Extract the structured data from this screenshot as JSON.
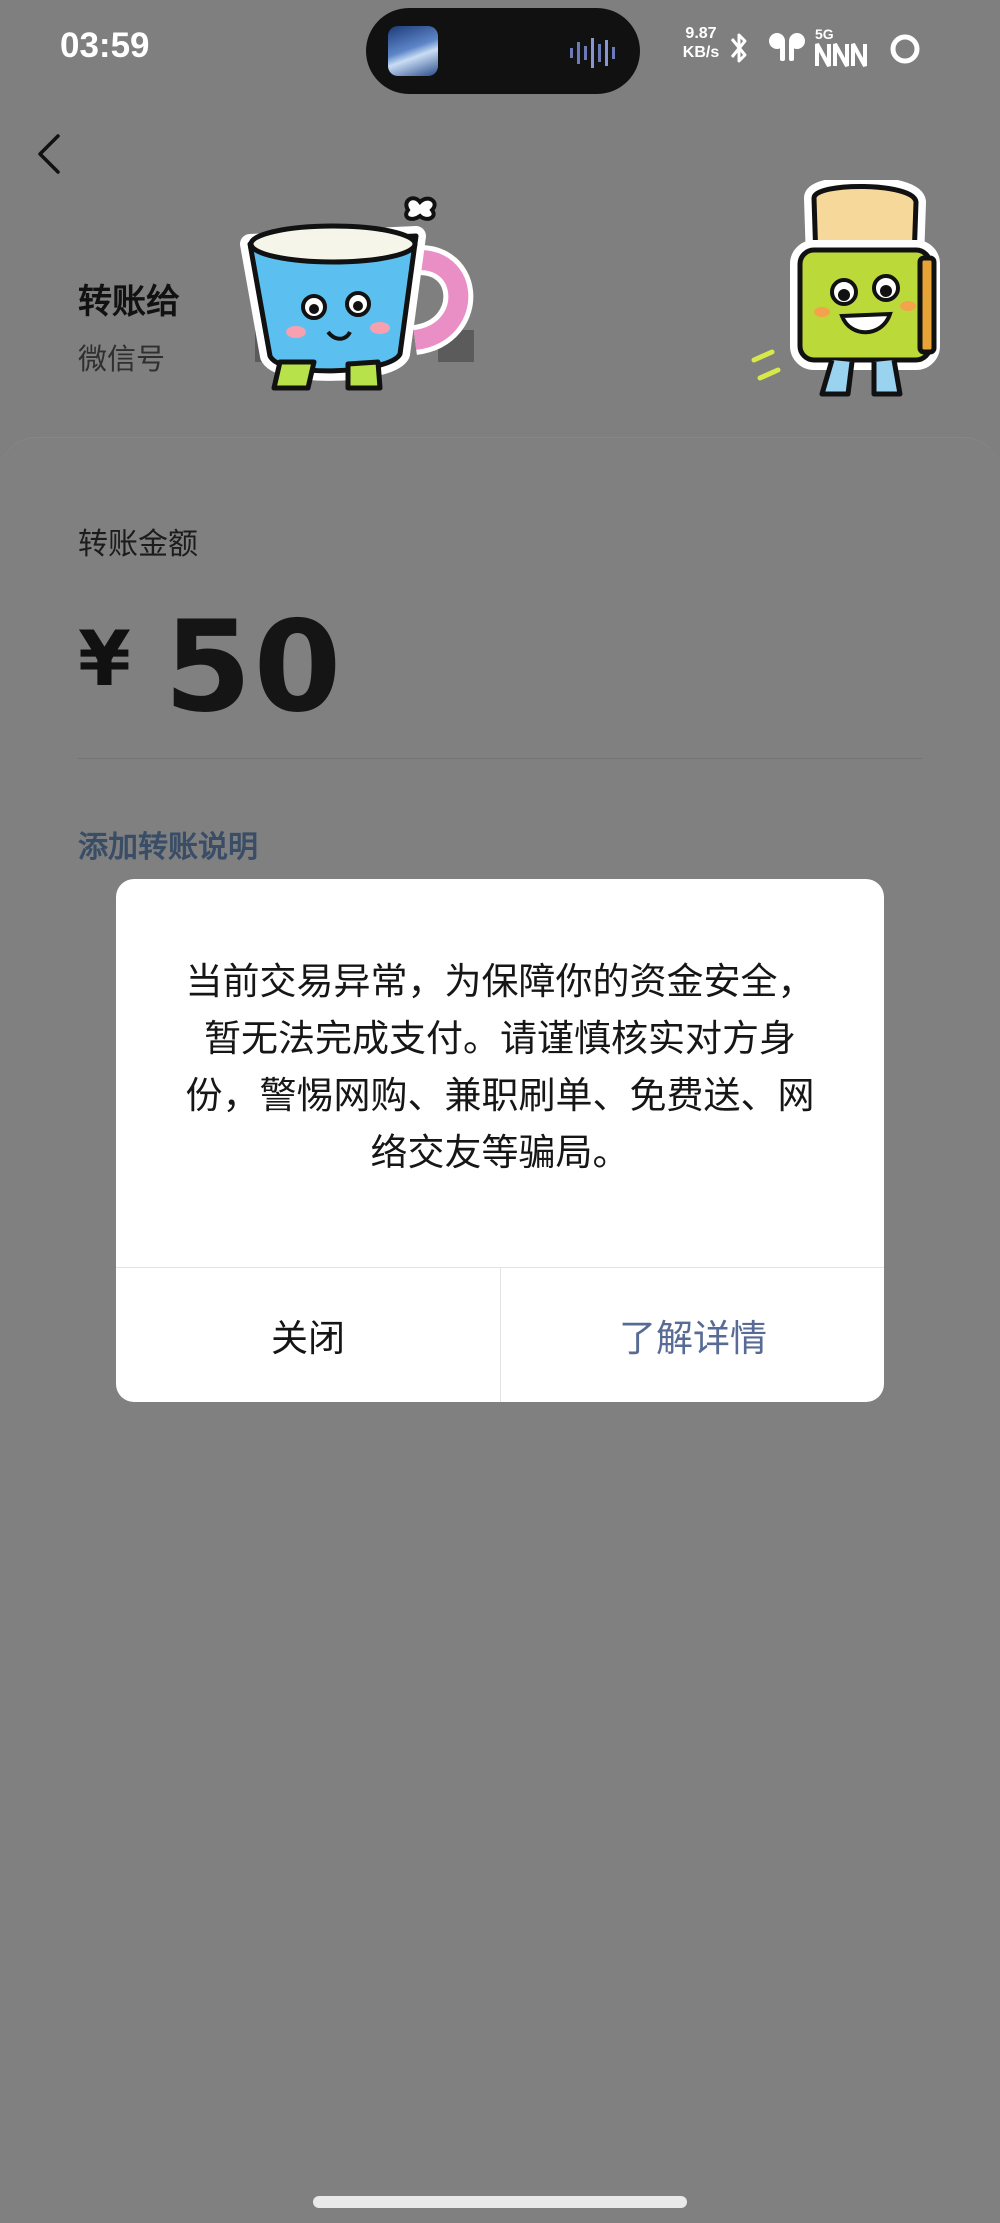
{
  "status_bar": {
    "time": "03:59",
    "net_speed_value": "9.87",
    "net_speed_unit": "KB/s",
    "network_type": "5G",
    "icons": [
      "bluetooth-icon",
      "earbuds-icon",
      "signal-icon",
      "circle-status-icon"
    ],
    "media_thumbnail": "media-thumbnail",
    "media_waveform": "audio-waveform-icon"
  },
  "header": {
    "back_icon": "chevron-left-icon",
    "to_label": "转账给",
    "wechat_id_label": "微信号"
  },
  "stickers": [
    "mug-sticker",
    "toast-sticker"
  ],
  "transfer": {
    "amount_label": "转账金额",
    "currency_symbol": "¥",
    "amount": "50",
    "add_note_link": "添加转账说明"
  },
  "dialog": {
    "message": "当前交易异常，为保障你的资金安全，暂无法完成支付。请谨慎核实对方身份，警惕网购、兼职刷单、免费送、网络交友等骗局。",
    "close_button": "关闭",
    "learn_more_button": "了解详情"
  },
  "colors": {
    "overlay_bg": "#7f7f7f",
    "link_blue": "#576b95",
    "dialog_bg": "#ffffff"
  }
}
